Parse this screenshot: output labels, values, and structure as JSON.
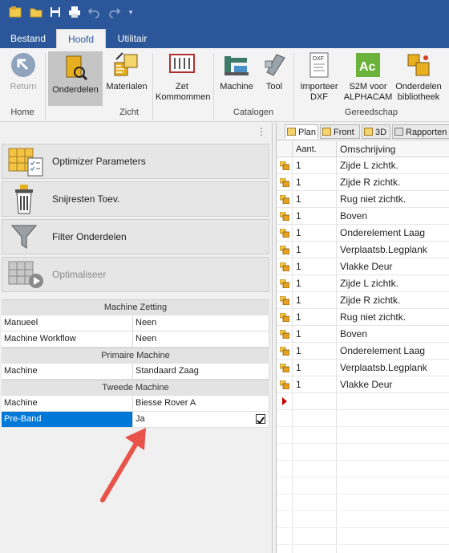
{
  "quick_access": [
    "app-icon",
    "open-icon",
    "save-icon",
    "print-icon",
    "undo-icon",
    "redo-icon",
    "customize-icon"
  ],
  "ribbon": {
    "tabs": [
      {
        "label": "Bestand",
        "active": false
      },
      {
        "label": "Hoofd",
        "active": true
      },
      {
        "label": "Utilitair",
        "active": false
      }
    ],
    "buttons": {
      "return": "Return",
      "onderdelen": "Onderdelen",
      "materialen": "Materialen",
      "zet_kommommen_1": "Zet",
      "zet_kommommen_2": "Kommommen",
      "machine": "Machine",
      "tool": "Tool",
      "importeer_1": "Importeer",
      "importeer_2": "DXF",
      "s2m_1": "S2M voor",
      "s2m_2": "ALPHACAM",
      "bib_1": "Onderdelen",
      "bib_2": "bibliotheek"
    },
    "groups": {
      "home": "Home",
      "zicht": "Zicht",
      "catalogen": "Catalogen",
      "gereedschap": "Gereedschap"
    },
    "icon_texts": {
      "dxf": "DXF",
      "ac": "Ac"
    }
  },
  "left": {
    "actions": [
      {
        "label": "Optimizer Parameters",
        "enabled": true
      },
      {
        "label": "Snijresten Toev.",
        "enabled": true
      },
      {
        "label": "Filter Onderdelen",
        "enabled": true
      },
      {
        "label": "Optimaliseer",
        "enabled": false
      }
    ],
    "properties": {
      "machine_zetting": "Machine Zetting",
      "manueel_k": "Manueel",
      "manueel_v": "Neen",
      "workflow_k": "Machine Workflow",
      "workflow_v": "Neen",
      "primaire": "Primaire Machine",
      "prim_machine_k": "Machine",
      "prim_machine_v": "Standaard Zaag",
      "tweede": "Tweede Machine",
      "tw_machine_k": "Machine",
      "tw_machine_v": "Biesse Rover A",
      "preband_k": "Pre-Band",
      "preband_v": "Ja",
      "preband_checked": true
    }
  },
  "right": {
    "tabs": [
      "Plan",
      "Front",
      "3D",
      "Rapporten"
    ],
    "columns": {
      "aant": "Aant.",
      "omschrijving": "Omschrijving"
    },
    "rows": [
      {
        "aant": "1",
        "omschrijving": "Zijde L zichtk."
      },
      {
        "aant": "1",
        "omschrijving": "Zijde R zichtk."
      },
      {
        "aant": "1",
        "omschrijving": "Rug niet zichtk."
      },
      {
        "aant": "1",
        "omschrijving": "Boven"
      },
      {
        "aant": "1",
        "omschrijving": "Onderelement Laag"
      },
      {
        "aant": "1",
        "omschrijving": "Verplaatsb.Legplank"
      },
      {
        "aant": "1",
        "omschrijving": "Vlakke Deur"
      },
      {
        "aant": "1",
        "omschrijving": "Zijde L zichtk."
      },
      {
        "aant": "1",
        "omschrijving": "Zijde R zichtk."
      },
      {
        "aant": "1",
        "omschrijving": "Rug niet zichtk."
      },
      {
        "aant": "1",
        "omschrijving": "Boven"
      },
      {
        "aant": "1",
        "omschrijving": "Onderelement Laag"
      },
      {
        "aant": "1",
        "omschrijving": "Verplaatsb.Legplank"
      },
      {
        "aant": "1",
        "omschrijving": "Vlakke Deur"
      }
    ]
  },
  "colors": {
    "ribbon_blue": "#2b579a",
    "selection_blue": "#0078d7",
    "arrow_red": "#e8534a",
    "row_marker": "#cc0000"
  }
}
